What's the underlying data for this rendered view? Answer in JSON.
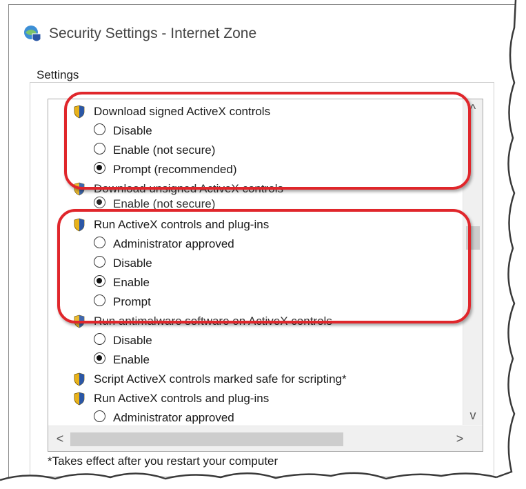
{
  "window": {
    "title": "Security Settings - Internet Zone",
    "icon": "globe-shield-icon"
  },
  "settings": {
    "group_label": "Settings",
    "tree_items": [
      {
        "kind": "category",
        "label": "Download signed ActiveX controls"
      },
      {
        "kind": "option",
        "label": "Disable",
        "selected": false
      },
      {
        "kind": "option",
        "label": "Enable (not secure)",
        "selected": false
      },
      {
        "kind": "option",
        "label": "Prompt (recommended)",
        "selected": true
      },
      {
        "kind": "category",
        "label": "Download unsigned ActiveX controls"
      },
      {
        "kind": "option",
        "label": "Enable (not secure)",
        "selected": true
      },
      {
        "kind": "category",
        "label": "Run ActiveX controls and plug-ins"
      },
      {
        "kind": "option",
        "label": "Administrator approved",
        "selected": false
      },
      {
        "kind": "option",
        "label": "Disable",
        "selected": false
      },
      {
        "kind": "option",
        "label": "Enable",
        "selected": true
      },
      {
        "kind": "option",
        "label": "Prompt",
        "selected": false
      },
      {
        "kind": "category",
        "label": "Run antimalware software on ActiveX controls"
      },
      {
        "kind": "option",
        "label": "Disable",
        "selected": false
      },
      {
        "kind": "option",
        "label": "Enable",
        "selected": true
      },
      {
        "kind": "category",
        "label": "Script ActiveX controls marked safe for scripting*"
      },
      {
        "kind": "category",
        "label": "Run ActiveX controls and plug-ins"
      },
      {
        "kind": "option",
        "label": "Administrator approved",
        "selected": false
      }
    ],
    "scroll_up_glyph": "^",
    "scroll_down_glyph": "v",
    "scroll_left_glyph": "<",
    "scroll_right_glyph": ">"
  },
  "footer_note": "*Takes effect after you restart your computer",
  "colors": {
    "highlight": "#e0262b",
    "shield_gold": "#e8b21a",
    "shield_blue": "#2b57a6"
  }
}
